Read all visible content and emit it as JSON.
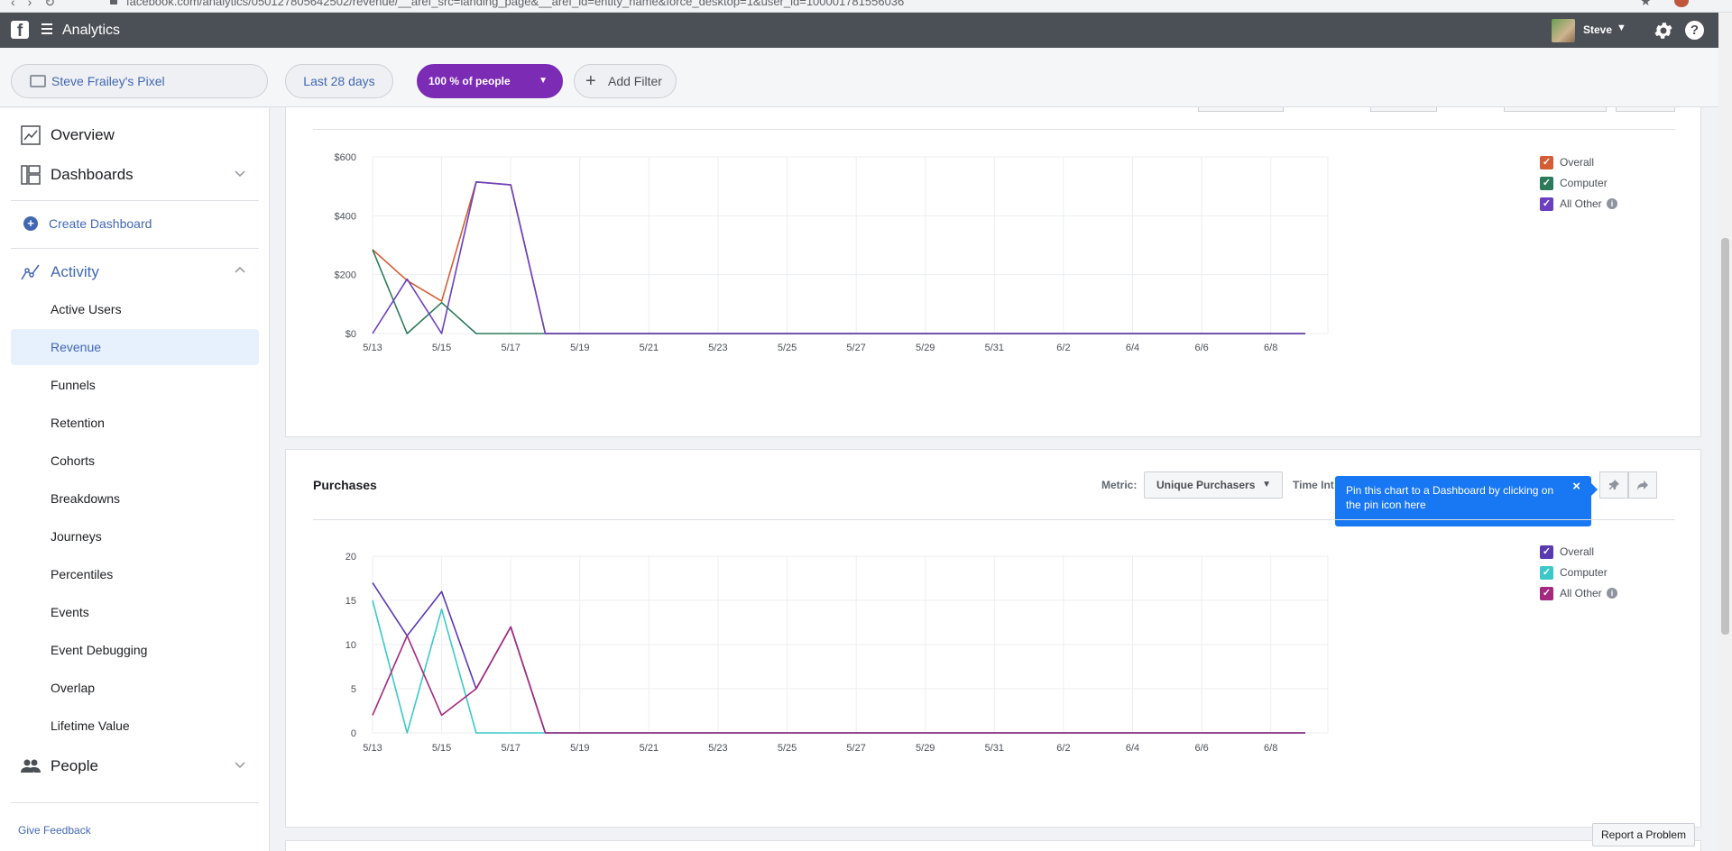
{
  "browser": {
    "url": "facebook.com/analytics/050127805642502/revenue/__aref_src=landing_page&__aref_id=entity_name&force_desktop=1&user_id=100001781556036"
  },
  "topbar": {
    "app_title": "Analytics",
    "user_name": "Steve"
  },
  "filters": {
    "pixel": "Steve Frailey's Pixel",
    "date_range": "Last 28 days",
    "people": "100 % of people",
    "add_filter": "Add Filter"
  },
  "sidebar": {
    "overview": "Overview",
    "dashboards": "Dashboards",
    "create_dashboard": "Create Dashboard",
    "activity": "Activity",
    "activity_items": [
      "Active Users",
      "Revenue",
      "Funnels",
      "Retention",
      "Cohorts",
      "Breakdowns",
      "Journeys",
      "Percentiles",
      "Events",
      "Event Debugging",
      "Overlap",
      "Lifetime Value"
    ],
    "active_item": "Revenue",
    "people": "People",
    "give_feedback": "Give Feedback"
  },
  "purchases_card": {
    "title": "Purchases",
    "metric_label": "Metric:",
    "metric_value": "Unique Purchasers",
    "time_interval_label": "Time Int",
    "tooltip": "Pin this chart to a Dashboard by clicking on the pin icon here",
    "tooltip_close": "×"
  },
  "report_problem": "Report a Problem",
  "chart_data": [
    {
      "type": "line",
      "x": [
        "5/13",
        "5/14",
        "5/15",
        "5/16",
        "5/17",
        "5/18",
        "5/19",
        "5/20",
        "5/21",
        "5/22",
        "5/23",
        "5/24",
        "5/25",
        "5/26",
        "5/27",
        "5/28",
        "5/29",
        "5/30",
        "5/31",
        "6/1",
        "6/2",
        "6/3",
        "6/4",
        "6/5",
        "6/6",
        "6/7",
        "6/8",
        "6/9"
      ],
      "x_tick_labels": [
        "5/13",
        "5/15",
        "5/17",
        "5/19",
        "5/21",
        "5/23",
        "5/25",
        "5/27",
        "5/29",
        "5/31",
        "6/2",
        "6/4",
        "6/6",
        "6/8"
      ],
      "y_ticks": [
        0,
        200,
        400,
        600
      ],
      "y_tick_labels": [
        "$0",
        "$200",
        "$400",
        "$600"
      ],
      "ylim": [
        0,
        600
      ],
      "grid": true,
      "legend": "right",
      "series": [
        {
          "name": "Overall",
          "color": "#d45d35",
          "values": [
            285,
            180,
            110,
            515,
            505,
            0,
            0,
            0,
            0,
            0,
            0,
            0,
            0,
            0,
            0,
            0,
            0,
            0,
            0,
            0,
            0,
            0,
            0,
            0,
            0,
            0,
            0,
            0
          ]
        },
        {
          "name": "Computer",
          "color": "#2d7a5a",
          "values": [
            285,
            0,
            105,
            0,
            0,
            0,
            0,
            0,
            0,
            0,
            0,
            0,
            0,
            0,
            0,
            0,
            0,
            0,
            0,
            0,
            0,
            0,
            0,
            0,
            0,
            0,
            0,
            0
          ]
        },
        {
          "name": "All Other",
          "color": "#6a3fc0",
          "values": [
            0,
            185,
            0,
            515,
            505,
            0,
            0,
            0,
            0,
            0,
            0,
            0,
            0,
            0,
            0,
            0,
            0,
            0,
            0,
            0,
            0,
            0,
            0,
            0,
            0,
            0,
            0,
            0
          ]
        }
      ]
    },
    {
      "type": "line",
      "title": "Purchases",
      "x": [
        "5/13",
        "5/14",
        "5/15",
        "5/16",
        "5/17",
        "5/18",
        "5/19",
        "5/20",
        "5/21",
        "5/22",
        "5/23",
        "5/24",
        "5/25",
        "5/26",
        "5/27",
        "5/28",
        "5/29",
        "5/30",
        "5/31",
        "6/1",
        "6/2",
        "6/3",
        "6/4",
        "6/5",
        "6/6",
        "6/7",
        "6/8",
        "6/9"
      ],
      "x_tick_labels": [
        "5/13",
        "5/15",
        "5/17",
        "5/19",
        "5/21",
        "5/23",
        "5/25",
        "5/27",
        "5/29",
        "5/31",
        "6/2",
        "6/4",
        "6/6",
        "6/8"
      ],
      "y_ticks": [
        0,
        5,
        10,
        15,
        20
      ],
      "y_tick_labels": [
        "0",
        "5",
        "10",
        "15",
        "20"
      ],
      "ylim": [
        0,
        20
      ],
      "grid": true,
      "legend": "right",
      "series": [
        {
          "name": "Overall",
          "color": "#5b39b3",
          "values": [
            17,
            11,
            16,
            5,
            12,
            0,
            0,
            0,
            0,
            0,
            0,
            0,
            0,
            0,
            0,
            0,
            0,
            0,
            0,
            0,
            0,
            0,
            0,
            0,
            0,
            0,
            0,
            0
          ]
        },
        {
          "name": "Computer",
          "color": "#3cc8c8",
          "values": [
            15,
            0,
            14,
            0,
            0,
            0,
            0,
            0,
            0,
            0,
            0,
            0,
            0,
            0,
            0,
            0,
            0,
            0,
            0,
            0,
            0,
            0,
            0,
            0,
            0,
            0,
            0,
            0
          ]
        },
        {
          "name": "All Other",
          "color": "#a3287e",
          "values": [
            2,
            11,
            2,
            5,
            12,
            0,
            0,
            0,
            0,
            0,
            0,
            0,
            0,
            0,
            0,
            0,
            0,
            0,
            0,
            0,
            0,
            0,
            0,
            0,
            0,
            0,
            0,
            0
          ]
        }
      ]
    }
  ]
}
